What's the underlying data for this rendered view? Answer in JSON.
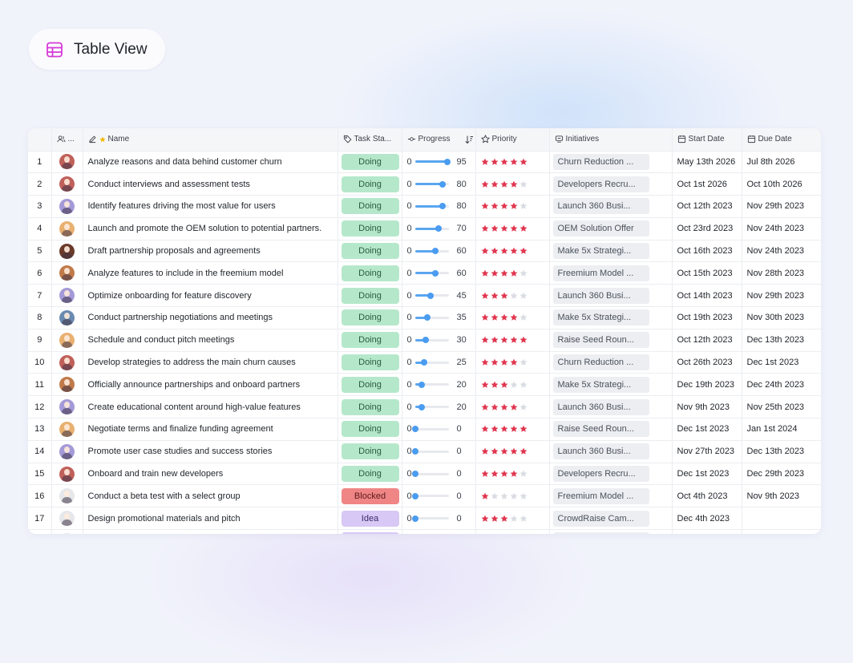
{
  "view": {
    "title": "Table View"
  },
  "columns": {
    "assignee": "...",
    "name": "Name",
    "status": "Task Sta...",
    "progress": "Progress",
    "priority": "Priority",
    "initiatives": "Initiatives",
    "start": "Start Date",
    "due": "Due Date"
  },
  "colors": {
    "doing_bg": "#b5e8cb",
    "doing_fg": "#2a5c3f",
    "blocked_bg": "#f08585",
    "blocked_fg": "#5a1a1a",
    "idea_bg": "#d7c8f5",
    "idea_fg": "#3d2a6a",
    "star_on": "#e0364f",
    "star_off": "#d9dce2",
    "progress_accent": "#4a9cf0"
  },
  "rows": [
    {
      "idx": "1",
      "avatar": "#c0605a",
      "name": "Analyze reasons and data behind customer churn",
      "status": "Doing",
      "status_key": "doing",
      "progress_low": "0",
      "progress": "95",
      "stars": 5,
      "initiative": "Churn Reduction ...",
      "start": "May 13th 2026",
      "due": "Jul 8th 2026"
    },
    {
      "idx": "2",
      "avatar": "#c0605a",
      "name": "Conduct interviews and assessment tests",
      "status": "Doing",
      "status_key": "doing",
      "progress_low": "0",
      "progress": "80",
      "stars": 4,
      "initiative": "Developers Recru...",
      "start": "Oct 1st 2026",
      "due": "Oct 10th 2026"
    },
    {
      "idx": "3",
      "avatar": "#a49ad8",
      "name": "Identify features driving the most value for users",
      "status": "Doing",
      "status_key": "doing",
      "progress_low": "0",
      "progress": "80",
      "stars": 4,
      "initiative": "Launch 360 Busi...",
      "start": "Oct 12th 2023",
      "due": "Nov 29th 2023"
    },
    {
      "idx": "4",
      "avatar": "#e8b070",
      "name": "Launch and promote the OEM solution to potential partners.",
      "status": "Doing",
      "status_key": "doing",
      "progress_low": "0",
      "progress": "70",
      "stars": 5,
      "initiative": "OEM Solution Offer",
      "start": "Oct 23rd 2023",
      "due": "Nov 24th 2023"
    },
    {
      "idx": "5",
      "avatar": "#6a3a2a",
      "name": "Draft partnership proposals and agreements",
      "status": "Doing",
      "status_key": "doing",
      "progress_low": "0",
      "progress": "60",
      "stars": 5,
      "initiative": "Make 5x Strategi...",
      "start": "Oct 16th 2023",
      "due": "Nov 24th 2023"
    },
    {
      "idx": "6",
      "avatar": "#c07a4a",
      "name": "Analyze features to include in the freemium model",
      "status": "Doing",
      "status_key": "doing",
      "progress_low": "0",
      "progress": "60",
      "stars": 4,
      "initiative": "Freemium Model ...",
      "start": "Oct 15th 2023",
      "due": "Nov 28th 2023"
    },
    {
      "idx": "7",
      "avatar": "#a49ad8",
      "name": "Optimize onboarding for feature discovery",
      "status": "Doing",
      "status_key": "doing",
      "progress_low": "0",
      "progress": "45",
      "stars": 3,
      "initiative": "Launch 360 Busi...",
      "start": "Oct 14th 2023",
      "due": "Nov 29th 2023"
    },
    {
      "idx": "8",
      "avatar": "#6a8ab0",
      "name": "Conduct partnership negotiations and meetings",
      "status": "Doing",
      "status_key": "doing",
      "progress_low": "0",
      "progress": "35",
      "stars": 4,
      "initiative": "Make 5x Strategi...",
      "start": "Oct 19th 2023",
      "due": "Nov 30th 2023"
    },
    {
      "idx": "9",
      "avatar": "#e8b070",
      "name": "Schedule and conduct pitch meetings",
      "status": "Doing",
      "status_key": "doing",
      "progress_low": "0",
      "progress": "30",
      "stars": 5,
      "initiative": "Raise Seed Roun...",
      "start": "Oct 12th 2023",
      "due": "Dec 13th 2023"
    },
    {
      "idx": "10",
      "avatar": "#c0605a",
      "name": "Develop strategies to address the main churn causes",
      "status": "Doing",
      "status_key": "doing",
      "progress_low": "0",
      "progress": "25",
      "stars": 4,
      "initiative": "Churn Reduction ...",
      "start": "Oct 26th 2023",
      "due": "Dec 1st 2023"
    },
    {
      "idx": "11",
      "avatar": "#c07a4a",
      "name": "Officially announce partnerships and onboard partners",
      "status": "Doing",
      "status_key": "doing",
      "progress_low": "0",
      "progress": "20",
      "stars": 3,
      "initiative": "Make 5x Strategi...",
      "start": "Dec 19th 2023",
      "due": "Dec 24th 2023"
    },
    {
      "idx": "12",
      "avatar": "#a49ad8",
      "name": "Create educational content around high-value features",
      "status": "Doing",
      "status_key": "doing",
      "progress_low": "0",
      "progress": "20",
      "stars": 4,
      "initiative": "Launch 360 Busi...",
      "start": "Nov 9th 2023",
      "due": "Nov 25th 2023"
    },
    {
      "idx": "13",
      "avatar": "#e8b070",
      "name": "Negotiate terms and finalize funding agreement",
      "status": "Doing",
      "status_key": "doing",
      "progress_low": "0",
      "progress": "0",
      "stars": 5,
      "initiative": "Raise Seed Roun...",
      "start": "Dec 1st 2023",
      "due": "Jan 1st 2024"
    },
    {
      "idx": "14",
      "avatar": "#a49ad8",
      "name": "Promote user case studies and success stories",
      "status": "Doing",
      "status_key": "doing",
      "progress_low": "0",
      "progress": "0",
      "stars": 5,
      "initiative": "Launch 360 Busi...",
      "start": "Nov 27th 2023",
      "due": "Dec 13th 2023"
    },
    {
      "idx": "15",
      "avatar": "#c0605a",
      "name": "Onboard and train new developers",
      "status": "Doing",
      "status_key": "doing",
      "progress_low": "0",
      "progress": "0",
      "stars": 4,
      "initiative": "Developers Recru...",
      "start": "Dec 1st 2023",
      "due": "Dec 29th 2023"
    },
    {
      "idx": "16",
      "avatar": "#e6e7ea",
      "name": "Conduct a beta test with a select group",
      "status": "Blocked",
      "status_key": "blocked",
      "progress_low": "0",
      "progress": "0",
      "stars": 1,
      "initiative": "Freemium Model ...",
      "start": "Oct 4th 2023",
      "due": "Nov 9th 2023"
    },
    {
      "idx": "17",
      "avatar": "#e6e7ea",
      "name": "Design promotional materials and pitch",
      "status": "Idea",
      "status_key": "idea",
      "progress_low": "0",
      "progress": "0",
      "stars": 3,
      "initiative": "CrowdRaise Cam...",
      "start": "Dec 4th 2023",
      "due": ""
    }
  ]
}
